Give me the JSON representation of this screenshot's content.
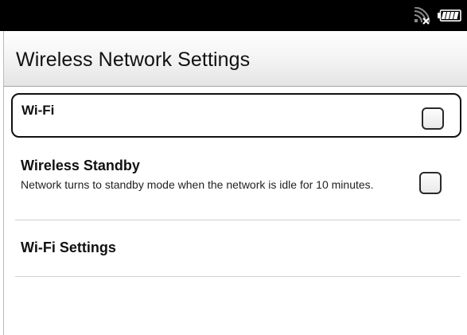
{
  "status_bar": {
    "icons": [
      "wifi-off-icon",
      "battery-icon"
    ]
  },
  "header": {
    "title": "Wireless Network Settings"
  },
  "settings": {
    "wifi": {
      "label": "Wi-Fi",
      "checked": false
    },
    "wireless_standby": {
      "label": "Wireless Standby",
      "description": "Network turns to standby mode when the network is idle for 10 minutes.",
      "checked": false
    },
    "wifi_settings": {
      "label": "Wi-Fi Settings"
    }
  }
}
